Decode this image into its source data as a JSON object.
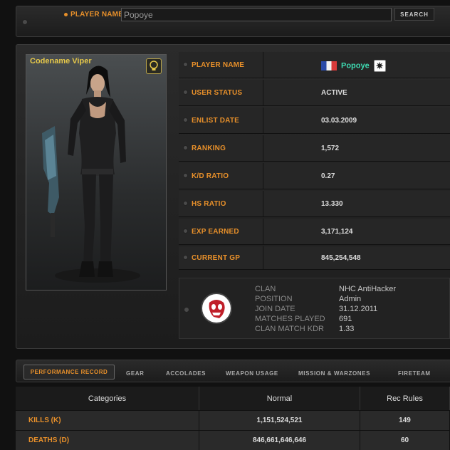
{
  "search": {
    "label": "PLAYER NAME",
    "value": "Popoye",
    "button_label": "SEARCH"
  },
  "character": {
    "name": "Codename Viper",
    "icon": "lightbulb-icon"
  },
  "player_info": [
    {
      "label": "PLAYER NAME",
      "value": "Popoye",
      "flag": "france-flag-icon",
      "rank_icon": "rank-badge-icon"
    },
    {
      "label": "USER STATUS",
      "value": "ACTIVE"
    },
    {
      "label": "ENLIST DATE",
      "value": "03.03.2009"
    },
    {
      "label": "RANKING",
      "value": "1,572"
    },
    {
      "label": "K/D RATIO",
      "value": "0.27"
    },
    {
      "label": "HS RATIO",
      "value": "13.330"
    },
    {
      "label": "EXP EARNED",
      "value": "3,171,124"
    },
    {
      "label": "CURRENT GP",
      "value": "845,254,548"
    }
  ],
  "clan": {
    "labels": [
      "CLAN",
      "POSITION",
      "JOIN DATE",
      "MATCHES PLAYED",
      "CLAN MATCH KDR"
    ],
    "values": [
      "NHC AntiHacker",
      "Admin",
      "31.12.2011",
      "691",
      "1.33"
    ]
  },
  "tabs": [
    "PERFORMANCE RECORD",
    "GEAR",
    "ACCOLADES",
    "WEAPON USAGE",
    "MISSION & WARZONES",
    "FIRETEAM"
  ],
  "stats": {
    "headers": [
      "Categories",
      "Normal",
      "Rec Rules"
    ],
    "rows": [
      {
        "category": "KILLS (K)",
        "normal": "1,151,524,521",
        "rec": "149"
      },
      {
        "category": "DEATHS (D)",
        "normal": "846,661,646,646",
        "rec": "60"
      }
    ]
  }
}
